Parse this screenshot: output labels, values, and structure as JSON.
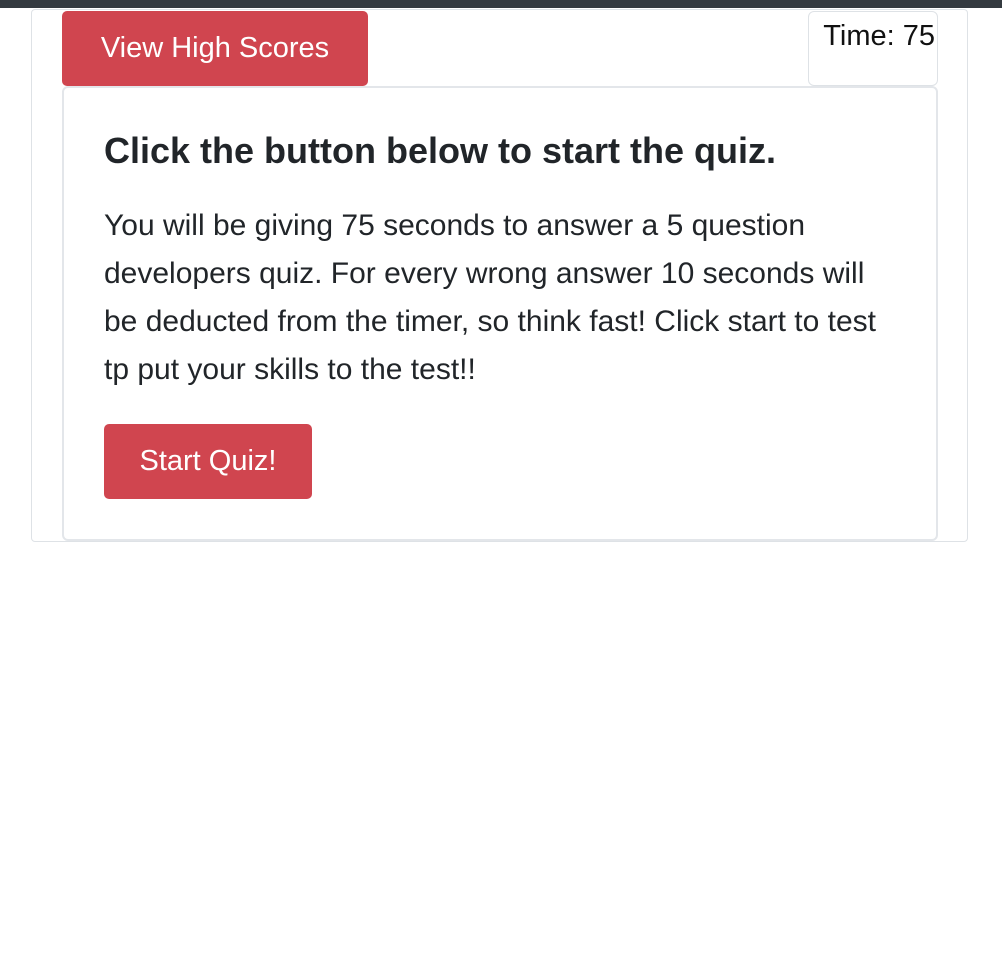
{
  "header": {
    "view_high_scores_label": "View High Scores",
    "timer_text": "Time: 75"
  },
  "intro": {
    "title": "Click the button below to start the quiz.",
    "description": "You will be giving 75 seconds to answer a 5 question developers quiz. For every wrong answer 10 seconds will be deducted from the timer, so think fast! Click start to test tp put your skills to the test!!",
    "start_button_label": "Start Quiz!"
  },
  "colors": {
    "button_danger": "#d0454f",
    "top_bar": "#343a40",
    "border": "#dee2e6"
  }
}
